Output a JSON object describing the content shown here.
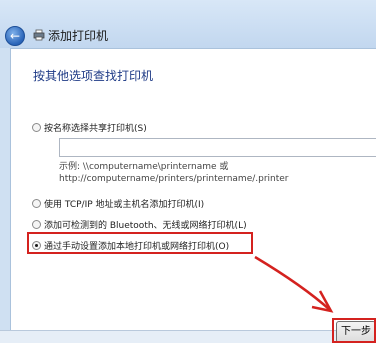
{
  "window": {
    "title": "添加打印机"
  },
  "content": {
    "heading": "按其他选项查找打印机"
  },
  "options": [
    {
      "label": "按名称选择共享打印机(S)",
      "checked": false
    },
    {
      "label": "使用 TCP/IP 地址或主机名添加打印机(I)",
      "checked": false
    },
    {
      "label": "添加可检测到的 Bluetooth、无线或网络打印机(L)",
      "checked": false
    },
    {
      "label": "通过手动设置添加本地打印机或网络打印机(O)",
      "checked": true
    }
  ],
  "shared_printer": {
    "input_value": "",
    "example_line1": "示例: \\\\computername\\printername 或",
    "example_line2": "http://computername/printers/printername/.printer"
  },
  "footer": {
    "next_label": "下一步"
  },
  "colors": {
    "highlight": "#d4221f",
    "heading": "#1e3a86"
  }
}
